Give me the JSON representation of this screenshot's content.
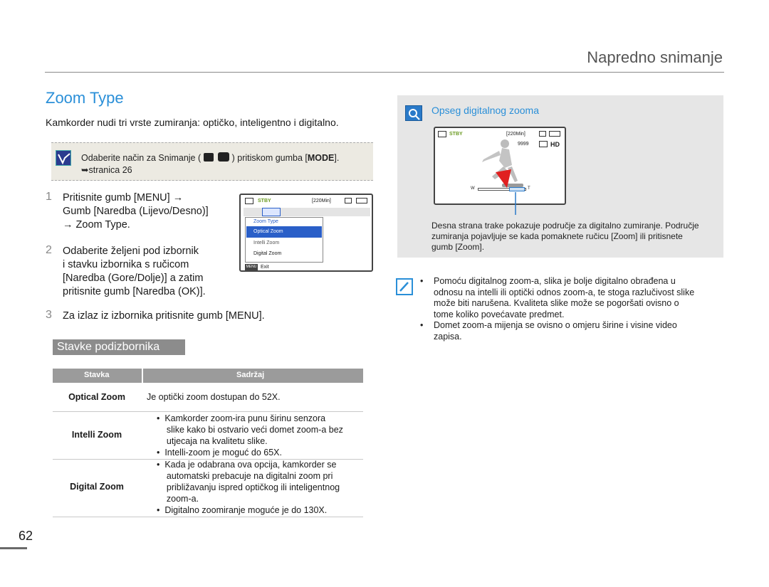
{
  "header": {
    "section_title": "Napredno snimanje"
  },
  "page": {
    "title": "Zoom Type",
    "intro": "Kamkorder nudi tri vrste zumiranja: optičko, inteligentno i digitalno.",
    "number": "62"
  },
  "note": {
    "line1_pre": "Odaberite način za Snimanje (",
    "line1_post": ") pritiskom gumba [",
    "mode_key": "MODE",
    "line1_end": "].",
    "line2": "➥stranica 26"
  },
  "steps": [
    {
      "num": "1",
      "lines": [
        "Pritisnite gumb [MENU] →",
        "Gumb [Naredba (Lijevo/Desno)]",
        "→ Zoom Type."
      ]
    },
    {
      "num": "2",
      "lines": [
        "Odaberite željeni pod izbornik",
        "i stavku izbornika s ručicom",
        "[Naredba (Gore/Dolje)] a zatim",
        "pritisnite gumb [Naredba (OK)]."
      ]
    },
    {
      "num": "3",
      "lines": [
        "Za izlaz iz izbornika pritisnite gumb [MENU]."
      ]
    }
  ],
  "lcd_menu": {
    "status": "STBY",
    "time": "[220Min]",
    "menu_title": "Zoom Type",
    "items": [
      "Optical Zoom",
      "Intelli Zoom",
      "Digital Zoom"
    ],
    "menu_key": "MENU",
    "exit": "Exit"
  },
  "submenu": {
    "heading": "Stavke podizbornika",
    "columns": [
      "Stavka",
      "Sadržaj"
    ],
    "rows": [
      {
        "name": "Optical Zoom",
        "lines": [
          "Je optički zoom dostupan do 52X."
        ]
      },
      {
        "name": "Intelli Zoom",
        "lines": [
          "•  Kamkorder zoom-ira punu širinu senzora",
          "    slike kako bi ostvario veći domet zoom-a bez",
          "    utjecaja na kvalitetu slike.",
          "•  Intelli-zoom je moguć do 65X."
        ]
      },
      {
        "name": "Digital Zoom",
        "lines": [
          "•  Kada je odabrana ova opcija, kamkorder se",
          "    automatski prebacuje na digitalni zoom pri",
          "    približavanju ispred optičkog ili inteligentnog",
          "    zoom-a.",
          "•  Digitalno zoomiranje moguće je do 130X."
        ]
      }
    ]
  },
  "zoom_range": {
    "heading": "Opseg digitalnog zooma",
    "status": "STBY",
    "time": "[220Min]",
    "count": "9999",
    "hd": "HD",
    "w": "W",
    "t": "T",
    "caption": [
      "Desna strana trake pokazuje područje za digitalno zumiranje. Područje",
      "zumiranja pojavljuje se kada pomaknete ručicu [Zoom] ili pritisnete",
      "gumb [Zoom]."
    ]
  },
  "tips": [
    [
      "Pomoću digitalnog zoom-a, slika je bolje digitalno obrađena u",
      "odnosu na intelli ili optički odnos zoom-a, te stoga razlučivost slike",
      "može biti narušena. Kvaliteta slike može se pogoršati ovisno o",
      "tome koliko povećavate predmet."
    ],
    [
      "Domet zoom-a mijenja se ovisno o omjeru širine i visine video",
      "zapisa."
    ]
  ],
  "colors": {
    "accent": "#2a8fd8",
    "table_header": "#9b9b9b",
    "panel": "#e6e6e6",
    "note_bg": "#eceae2"
  }
}
